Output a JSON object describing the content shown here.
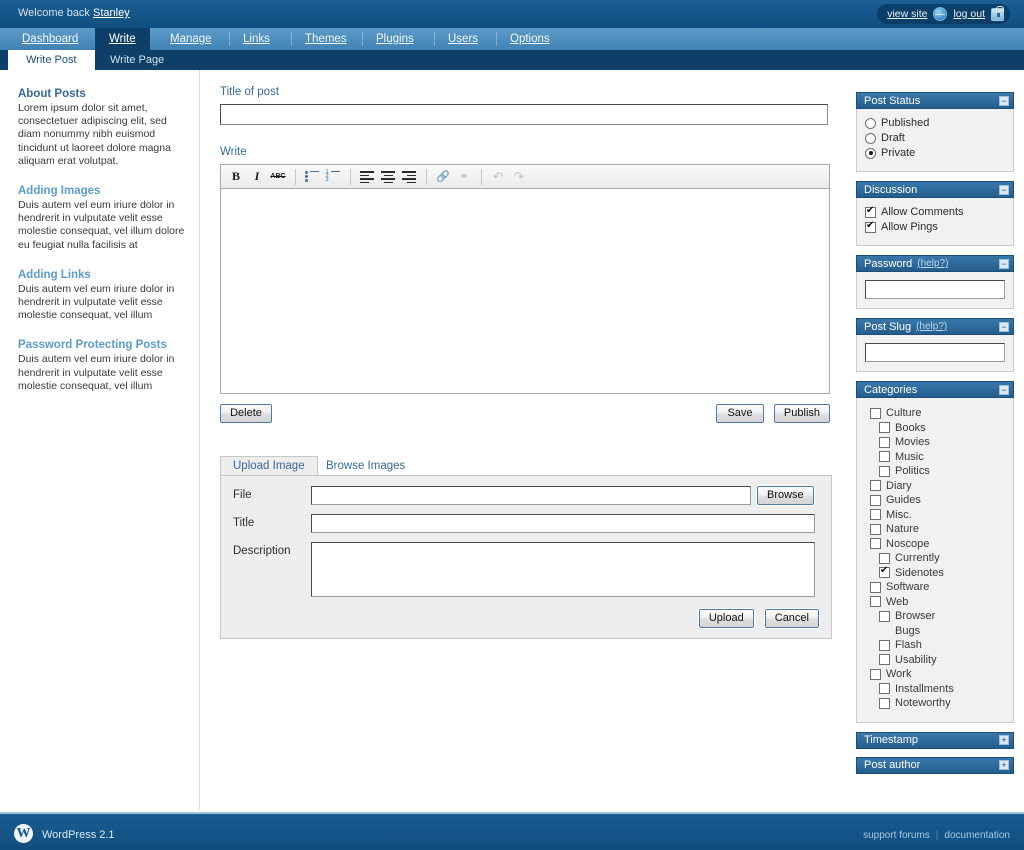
{
  "topbar": {
    "welcome_prefix": "Welcome back ",
    "username": "Stanley",
    "view_site": "view site",
    "log_out": "log out"
  },
  "mainnav": {
    "tabs": [
      {
        "label": "Dashboard",
        "active": false
      },
      {
        "label": "Write",
        "active": true
      },
      {
        "label": "Manage",
        "active": false
      },
      {
        "label": "Links",
        "active": false
      },
      {
        "label": "Themes",
        "active": false
      },
      {
        "label": "Plugins",
        "active": false
      },
      {
        "label": "Users",
        "active": false
      },
      {
        "label": "Options",
        "active": false
      }
    ]
  },
  "subnav": {
    "tabs": [
      {
        "label": "Write Post",
        "active": true
      },
      {
        "label": "Write Page",
        "active": false
      }
    ]
  },
  "sidebar": {
    "sections": [
      {
        "title": "About Posts",
        "text": "Lorem ipsum dolor sit amet, consectetuer adipiscing elit, sed diam nonummy nibh euismod tincidunt ut laoreet dolore magna aliquam erat volutpat."
      },
      {
        "title": "Adding Images",
        "text": "Duis autem vel eum iriure dolor in hendrerit in vulputate velit esse molestie consequat, vel illum dolore eu feugiat nulla facilisis at"
      },
      {
        "title": "Adding Links",
        "text": "Duis autem vel eum iriure dolor in hendrerit in vulputate velit esse molestie consequat, vel illum"
      },
      {
        "title": "Password Protecting Posts",
        "text": "Duis autem vel eum iriure dolor in hendrerit in vulputate velit esse molestie consequat, vel illum"
      }
    ]
  },
  "main": {
    "title_label": "Title of post",
    "title_value": "",
    "write_label": "Write",
    "content_value": "",
    "toolbar": {
      "bold": "B",
      "italic": "I",
      "strikethrough": "ABC",
      "unordered_list": "unordered-list",
      "ordered_list": "ordered-list",
      "align_left": "align-left",
      "align_center": "align-center",
      "align_right": "align-right",
      "link": "link",
      "unlink": "unlink",
      "undo": "undo",
      "redo": "redo"
    },
    "delete_label": "Delete",
    "save_label": "Save",
    "publish_label": "Publish"
  },
  "upload": {
    "tabs": [
      {
        "label": "Upload Image",
        "active": true
      },
      {
        "label": "Browse Images",
        "active": false
      }
    ],
    "file_label": "File",
    "file_value": "",
    "browse_label": "Browse",
    "title_label": "Title",
    "title_value": "",
    "description_label": "Description",
    "description_value": "",
    "upload_label": "Upload",
    "cancel_label": "Cancel"
  },
  "right": {
    "post_status": {
      "title": "Post Status",
      "toggle": "−",
      "options": [
        {
          "label": "Published",
          "selected": false
        },
        {
          "label": "Draft",
          "selected": false
        },
        {
          "label": "Private",
          "selected": true
        }
      ]
    },
    "discussion": {
      "title": "Discussion",
      "toggle": "−",
      "options": [
        {
          "label": "Allow Comments",
          "checked": true
        },
        {
          "label": "Allow Pings",
          "checked": true
        }
      ]
    },
    "password": {
      "title": "Password",
      "help": "(help?)",
      "toggle": "−",
      "value": ""
    },
    "post_slug": {
      "title": "Post Slug",
      "help": "(help?)",
      "toggle": "−",
      "value": ""
    },
    "categories": {
      "title": "Categories",
      "toggle": "−",
      "items": [
        {
          "label": "Culture",
          "depth": 0,
          "checked": false,
          "has_checkbox": true
        },
        {
          "label": "Books",
          "depth": 1,
          "checked": false,
          "has_checkbox": true
        },
        {
          "label": "Movies",
          "depth": 1,
          "checked": false,
          "has_checkbox": true
        },
        {
          "label": "Music",
          "depth": 1,
          "checked": false,
          "has_checkbox": true
        },
        {
          "label": "Politics",
          "depth": 1,
          "checked": false,
          "has_checkbox": true
        },
        {
          "label": "Diary",
          "depth": 0,
          "checked": false,
          "has_checkbox": true
        },
        {
          "label": "Guides",
          "depth": 0,
          "checked": false,
          "has_checkbox": true
        },
        {
          "label": "Misc.",
          "depth": 0,
          "checked": false,
          "has_checkbox": true
        },
        {
          "label": "Nature",
          "depth": 0,
          "checked": false,
          "has_checkbox": true
        },
        {
          "label": "Noscope",
          "depth": 0,
          "checked": false,
          "has_checkbox": true
        },
        {
          "label": "Currently",
          "depth": 1,
          "checked": false,
          "has_checkbox": true
        },
        {
          "label": "Sidenotes",
          "depth": 1,
          "checked": true,
          "has_checkbox": true
        },
        {
          "label": "Software",
          "depth": 0,
          "checked": false,
          "has_checkbox": true
        },
        {
          "label": "Web",
          "depth": 0,
          "checked": false,
          "has_checkbox": true
        },
        {
          "label": "Browser",
          "depth": 1,
          "checked": false,
          "has_checkbox": true
        },
        {
          "label": "Bugs",
          "depth": 1,
          "checked": false,
          "has_checkbox": false
        },
        {
          "label": "Flash",
          "depth": 1,
          "checked": false,
          "has_checkbox": true
        },
        {
          "label": "Usability",
          "depth": 1,
          "checked": false,
          "has_checkbox": true
        },
        {
          "label": "Work",
          "depth": 0,
          "checked": false,
          "has_checkbox": true
        },
        {
          "label": "Installments",
          "depth": 1,
          "checked": false,
          "has_checkbox": true
        },
        {
          "label": "Noteworthy",
          "depth": 1,
          "checked": false,
          "has_checkbox": true
        }
      ]
    },
    "timestamp": {
      "title": "Timestamp",
      "toggle": "+"
    },
    "post_author": {
      "title": "Post author",
      "toggle": "+"
    }
  },
  "footer": {
    "version": "WordPress 2.1",
    "support_forums": "support forums",
    "separator": "|",
    "documentation": "documentation"
  },
  "colors": {
    "header_blue": "#14568a",
    "nav_blue": "#4e90c0",
    "active_tab": "#0d3f68",
    "panel_head": "#2e6b9e",
    "link_blue": "#36699b",
    "heading_blue": "#5c9ccc"
  }
}
